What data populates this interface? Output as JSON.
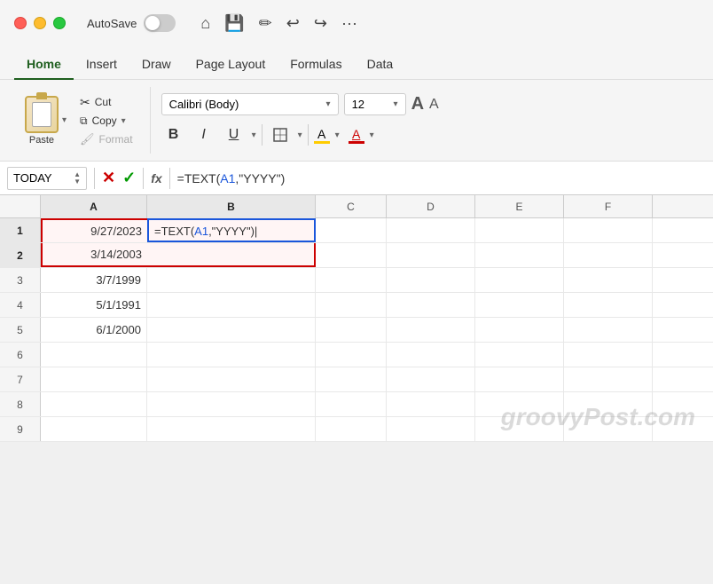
{
  "titlebar": {
    "autosave_label": "AutoSave",
    "icons": [
      "home",
      "save",
      "edit",
      "undo",
      "redo",
      "more"
    ]
  },
  "tabs": [
    "Home",
    "Insert",
    "Draw",
    "Page Layout",
    "Formulas",
    "Data"
  ],
  "active_tab": "Home",
  "clipboard": {
    "paste_label": "Paste",
    "cut_label": "Cut",
    "copy_label": "Copy",
    "format_label": "Format"
  },
  "font": {
    "name": "Calibri (Body)",
    "size": "12",
    "bold": "B",
    "italic": "I",
    "underline": "U"
  },
  "formula_bar": {
    "cell_name": "TODAY",
    "formula": "=TEXT(A1,\"YYYY\")"
  },
  "columns": [
    "A",
    "B",
    "C",
    "D",
    "E",
    "F"
  ],
  "rows": [
    {
      "num": "1",
      "a": "9/27/2023",
      "b": "=TEXT(A1,\"YYYY\")",
      "c": "",
      "d": "",
      "e": "",
      "f": ""
    },
    {
      "num": "2",
      "a": "3/14/2003",
      "b": "",
      "c": "",
      "d": "",
      "e": "",
      "f": ""
    },
    {
      "num": "3",
      "a": "3/7/1999",
      "b": "",
      "c": "",
      "d": "",
      "e": "",
      "f": ""
    },
    {
      "num": "4",
      "a": "5/1/1991",
      "b": "",
      "c": "",
      "d": "",
      "e": "",
      "f": ""
    },
    {
      "num": "5",
      "a": "6/1/2000",
      "b": "",
      "c": "",
      "d": "",
      "e": "",
      "f": ""
    },
    {
      "num": "6",
      "a": "",
      "b": "",
      "c": "",
      "d": "",
      "e": "",
      "f": ""
    },
    {
      "num": "7",
      "a": "",
      "b": "",
      "c": "",
      "d": "",
      "e": "",
      "f": ""
    },
    {
      "num": "8",
      "a": "",
      "b": "",
      "c": "",
      "d": "",
      "e": "",
      "f": ""
    },
    {
      "num": "9",
      "a": "",
      "b": "",
      "c": "",
      "d": "",
      "e": "",
      "f": ""
    }
  ],
  "watermark": "groovyPost.com",
  "colors": {
    "accent_green": "#1f5f1f",
    "selection_red": "#cc0000",
    "cell_blue": "#1a56db"
  }
}
